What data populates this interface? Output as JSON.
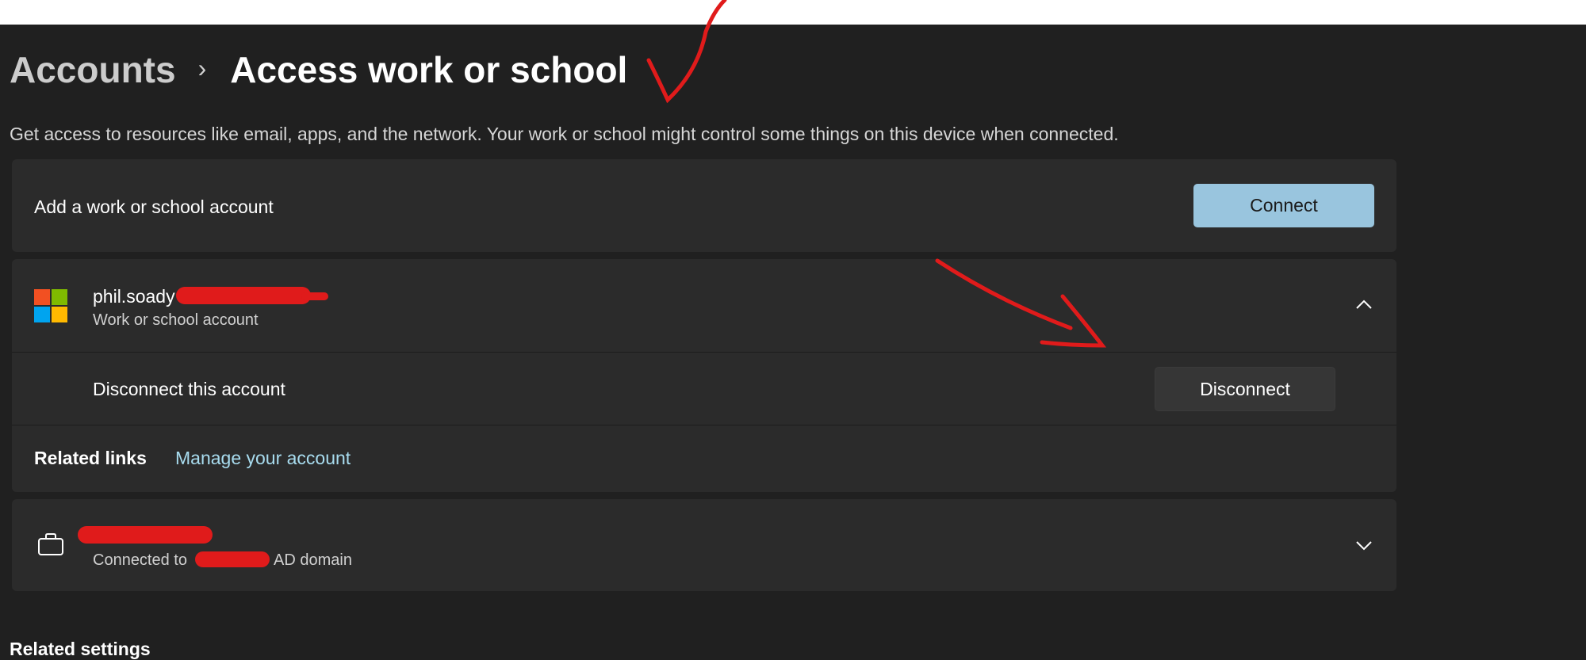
{
  "breadcrumb": {
    "parent": "Accounts",
    "separator": "›",
    "current": "Access work or school"
  },
  "description": "Get access to resources like email, apps, and the network. Your work or school might control some things on this device when connected.",
  "add_account": {
    "label": "Add a work or school account",
    "button": "Connect"
  },
  "ms_account": {
    "name": "phil.soady",
    "type": "Work or school account",
    "disconnect_label": "Disconnect this account",
    "disconnect_button": "Disconnect",
    "related_links_label": "Related links",
    "manage_link": "Manage your account"
  },
  "ad_account": {
    "connected_prefix": "Connected to",
    "connected_suffix": "AD domain"
  },
  "related_settings": "Related settings",
  "colors": {
    "accent": "#99c5de",
    "annotation": "#e01b1b",
    "ms_red": "#f25022",
    "ms_green": "#7fba00",
    "ms_blue": "#00a4ef",
    "ms_yellow": "#ffb900"
  }
}
